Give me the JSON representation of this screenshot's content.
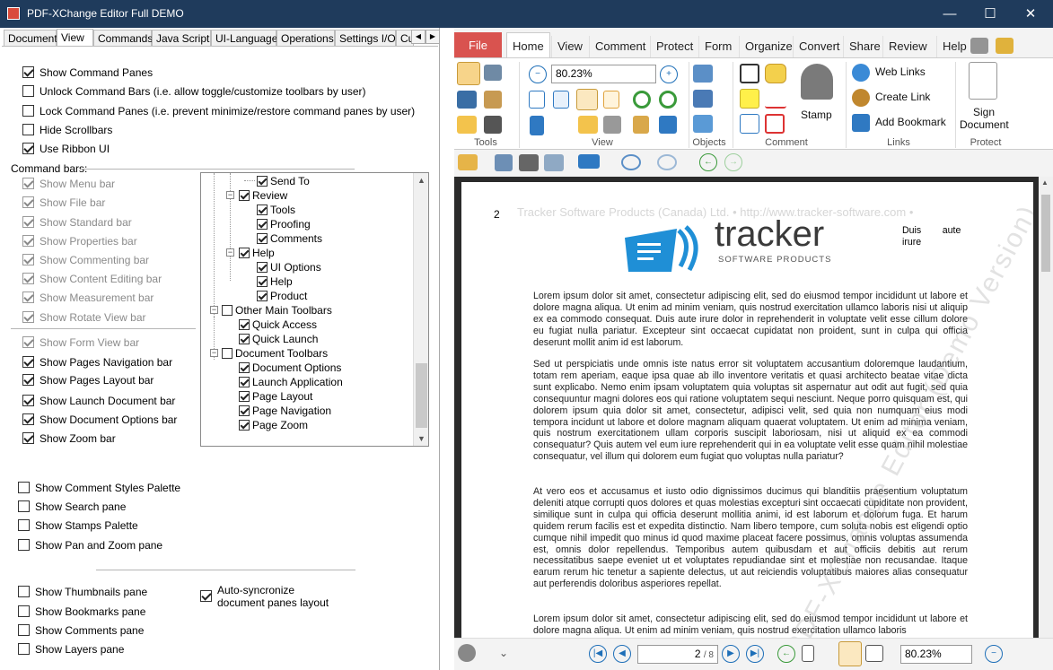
{
  "window": {
    "title": "PDF-XChange Editor Full DEMO",
    "minimize": "—",
    "maximize": "☐",
    "close": "✕"
  },
  "left": {
    "tabs": [
      "Document",
      "View",
      "Commands",
      "Java Script",
      "UI-Language",
      "Operations",
      "Settings I/O",
      "Cu"
    ],
    "active_tab": "View",
    "top_options": [
      {
        "label": "Show Command Panes",
        "checked": true
      },
      {
        "label": "Unlock Command Bars (i.e. allow toggle/customize toolbars by user)",
        "checked": false
      },
      {
        "label": "Lock Command Panes (i.e. prevent minimize/restore command panes by user)",
        "checked": false
      },
      {
        "label": "Hide Scrollbars",
        "checked": false
      },
      {
        "label": "Use Ribbon UI",
        "checked": true
      }
    ],
    "command_bars_label": "Command bars:",
    "bars_disabled": [
      "Show Menu bar",
      "Show File bar",
      "Show Standard bar",
      "Show Properties bar",
      "Show Commenting bar",
      "Show Content Editing bar",
      "Show Measurement bar",
      "Show Rotate View bar"
    ],
    "bars_enabled": [
      {
        "label": "Show Form View bar",
        "checked": true,
        "disabled": true
      },
      {
        "label": "Show Pages Navigation bar",
        "checked": true
      },
      {
        "label": "Show Pages Layout bar",
        "checked": true
      },
      {
        "label": "Show Launch Document bar",
        "checked": true
      },
      {
        "label": "Show Document Options bar",
        "checked": true
      },
      {
        "label": "Show Zoom bar",
        "checked": true
      }
    ],
    "tree": [
      {
        "label": "Send To",
        "level": 2,
        "checked": true
      },
      {
        "label": "Review",
        "level": 1,
        "checked": true,
        "expander": "−"
      },
      {
        "label": "Tools",
        "level": 2,
        "checked": true
      },
      {
        "label": "Proofing",
        "level": 2,
        "checked": true
      },
      {
        "label": "Comments",
        "level": 2,
        "checked": true
      },
      {
        "label": "Help",
        "level": 1,
        "checked": true,
        "expander": "−"
      },
      {
        "label": "UI Options",
        "level": 2,
        "checked": true
      },
      {
        "label": "Help",
        "level": 2,
        "checked": true
      },
      {
        "label": "Product",
        "level": 2,
        "checked": true
      },
      {
        "label": "Other Main Toolbars",
        "level": 0,
        "checked": false,
        "expander": "−"
      },
      {
        "label": "Quick Access",
        "level": 1,
        "checked": true
      },
      {
        "label": "Quick Launch",
        "level": 1,
        "checked": true
      },
      {
        "label": "Document Toolbars",
        "level": 0,
        "checked": false,
        "expander": "−"
      },
      {
        "label": "Document Options",
        "level": 1,
        "checked": true
      },
      {
        "label": "Launch Application",
        "level": 1,
        "checked": true
      },
      {
        "label": "Page Layout",
        "level": 1,
        "checked": true
      },
      {
        "label": "Page Navigation",
        "level": 1,
        "checked": true
      },
      {
        "label": "Page Zoom",
        "level": 1,
        "checked": true
      }
    ],
    "palettes": [
      {
        "label": "Show Comment Styles Palette",
        "checked": false
      },
      {
        "label": "Show Search pane",
        "checked": false
      },
      {
        "label": "Show Stamps Palette",
        "checked": false
      },
      {
        "label": "Show Pan and Zoom pane",
        "checked": false
      }
    ],
    "panes": [
      {
        "label": "Show Thumbnails pane",
        "checked": false
      },
      {
        "label": "Show Bookmarks pane",
        "checked": false
      },
      {
        "label": "Show Comments pane",
        "checked": false
      },
      {
        "label": "Show Layers pane",
        "checked": false
      }
    ],
    "autosync": {
      "line1": "Auto-syncronize",
      "line2": "document panes layout",
      "checked": true
    }
  },
  "ribbon": {
    "tabs": [
      "File",
      "Home",
      "View",
      "Comment",
      "Protect",
      "Form",
      "Organize",
      "Convert",
      "Share",
      "Review",
      "Help"
    ],
    "active_tab": "Home",
    "groups": [
      "Tools",
      "View",
      "Objects",
      "Comment",
      "Links",
      "Protect"
    ],
    "zoom_value": "80.23%",
    "stamp_label": "Stamp",
    "web_links": "Web Links",
    "create_link": "Create Link",
    "add_bookmark": "Add Bookmark",
    "sign_line1": "Sign",
    "sign_line2": "Document"
  },
  "document": {
    "page_number": "2",
    "header_watermark": "Tracker Software Products (Canada) Ltd. • http://www.tracker-software.com •",
    "logo_name": "tracker",
    "logo_sub": "SOFTWARE PRODUCTS",
    "side_text_1": "Duis        aute",
    "side_text_2": "irure",
    "diagonal_watermark": "PDF-XChange Editor (Demo Version)",
    "paragraphs": [
      "Lorem ipsum dolor sit amet, consectetur adipiscing elit, sed do eiusmod tempor incididunt ut labore et dolore magna aliqua. Ut enim ad minim veniam, quis nostrud exercitation ullamco laboris nisi ut aliquip ex ea commodo consequat. Duis aute irure dolor in reprehenderit in voluptate velit esse cillum dolore eu fugiat nulla pariatur. Excepteur sint occaecat cupidatat non proident, sunt in culpa qui officia deserunt mollit anim id est laborum.",
      "Sed ut perspiciatis unde omnis iste natus error sit voluptatem accusantium doloremque laudantium, totam rem aperiam, eaque ipsa quae ab illo inventore veritatis et quasi architecto beatae vitae dicta sunt explicabo. Nemo enim ipsam voluptatem quia voluptas sit aspernatur aut odit aut fugit, sed quia consequuntur magni dolores eos qui ratione voluptatem sequi nesciunt. Neque porro quisquam est, qui dolorem ipsum quia dolor sit amet, consectetur, adipisci velit, sed quia non numquam eius modi tempora incidunt ut labore et dolore magnam aliquam quaerat voluptatem. Ut enim ad minima veniam, quis nostrum exercitationem ullam corporis suscipit laboriosam, nisi ut aliquid ex ea commodi consequatur? Quis autem vel eum iure reprehenderit qui in ea voluptate velit esse quam nihil molestiae consequatur, vel illum qui dolorem eum fugiat quo voluptas nulla pariatur?",
      "At vero eos et accusamus et iusto odio dignissimos ducimus qui blanditiis praesentium voluptatum deleniti atque corrupti quos dolores et quas molestias excepturi sint occaecati cupiditate non provident, similique sunt in culpa qui officia deserunt mollitia animi, id est laborum et dolorum fuga. Et harum quidem rerum facilis est et expedita distinctio. Nam libero tempore, cum soluta nobis est eligendi optio cumque nihil impedit quo minus id quod maxime placeat facere possimus, omnis voluptas assumenda est, omnis dolor repellendus. Temporibus autem quibusdam et aut officiis debitis aut rerum necessitatibus saepe eveniet ut et voluptates repudiandae sint et molestiae non recusandae. Itaque earum rerum hic tenetur a sapiente delectus, ut aut reiciendis voluptatibus maiores alias consequatur aut perferendis doloribus asperiores repellat.",
      "Lorem ipsum dolor sit amet, consectetur adipiscing elit, sed do eiusmod tempor incididunt ut labore et dolore magna aliqua. Ut enim ad minim veniam, quis nostrud exercitation ullamco laboris"
    ]
  },
  "status": {
    "page_current": "2",
    "page_total": "/ 8",
    "zoom": "80.23%"
  },
  "colors": {
    "titlebar": "#1f3b5c",
    "file_tab": "#d9534f",
    "accent": "#1e6fb8",
    "doc_bg": "#2b2b2b"
  }
}
